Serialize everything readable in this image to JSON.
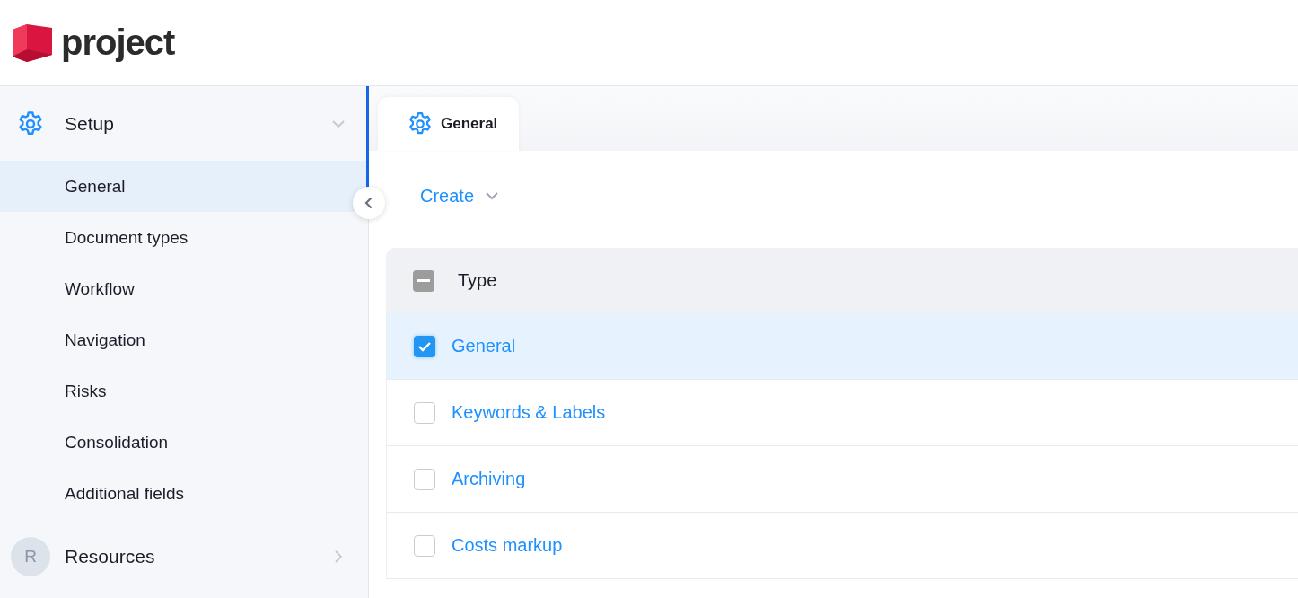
{
  "header": {
    "logo_text": "project"
  },
  "sidebar": {
    "groups": [
      {
        "label": "Setup",
        "kind": "settings",
        "expanded": true,
        "items": [
          {
            "label": "General",
            "selected": true
          },
          {
            "label": "Document types",
            "selected": false
          },
          {
            "label": "Workflow",
            "selected": false
          },
          {
            "label": "Navigation",
            "selected": false
          },
          {
            "label": "Risks",
            "selected": false
          },
          {
            "label": "Consolidation",
            "selected": false
          },
          {
            "label": "Additional fields",
            "selected": false
          }
        ]
      },
      {
        "label": "Resources",
        "kind": "avatar",
        "avatar": "R",
        "expanded": false
      }
    ]
  },
  "tabs": [
    {
      "label": "General",
      "selected": true
    }
  ],
  "toolbar": {
    "create_label": "Create"
  },
  "table": {
    "columns": [
      "Type"
    ],
    "select_all": {
      "partial": true
    },
    "rows": [
      {
        "type": "General",
        "checked": true,
        "selected": true
      },
      {
        "type": "Keywords & Labels",
        "checked": false,
        "selected": false
      },
      {
        "type": "Archiving",
        "checked": false,
        "selected": false
      },
      {
        "type": "Costs markup",
        "checked": false,
        "selected": false
      }
    ]
  }
}
